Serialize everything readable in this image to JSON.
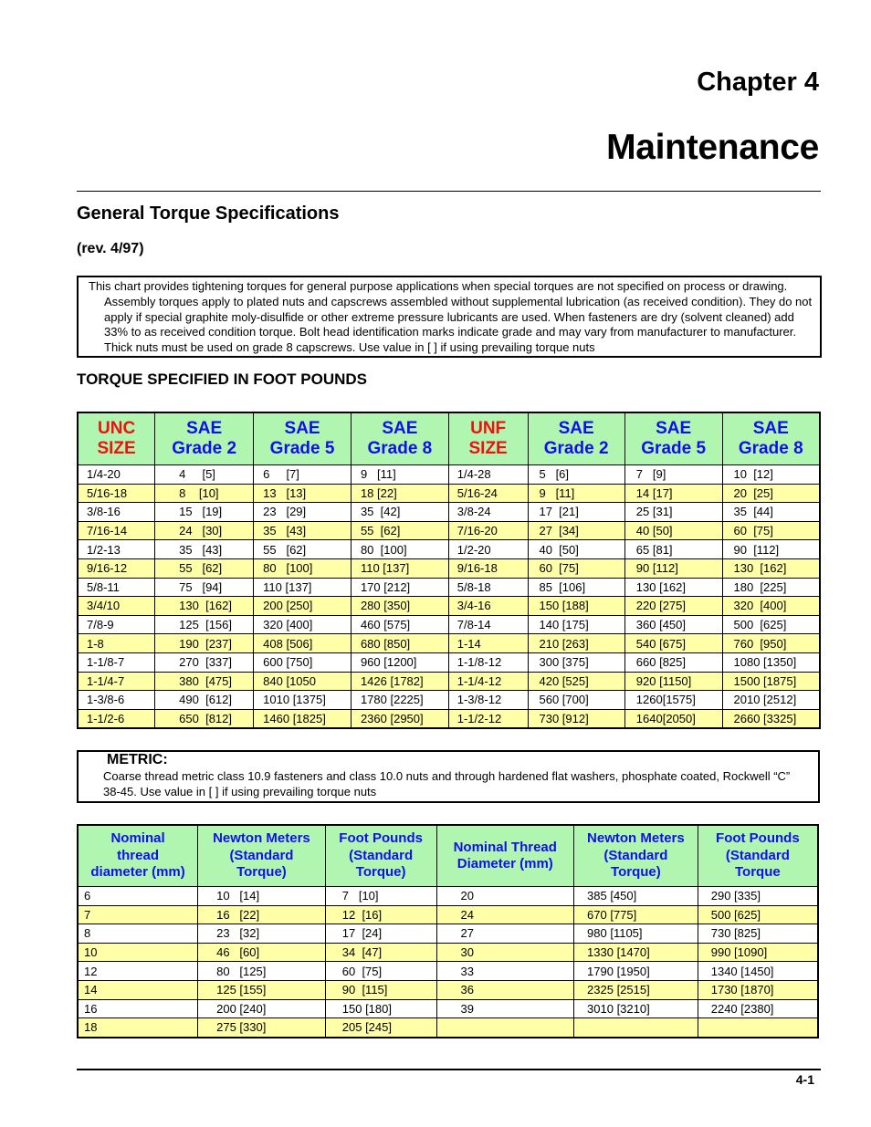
{
  "header": {
    "chapter": "Chapter 4",
    "title": "Maintenance"
  },
  "section": {
    "title": "General Torque Specifications",
    "revision": "(rev. 4/97)",
    "note": "This chart provides tightening torques for general purpose applications when special torques are not specified on process or drawing. Assembly torques apply to plated nuts and capscrews assembled without supplemental lubrication (as received condition). They do not apply if special graphite moly-disulfide or other extreme pressure lubricants are used. When fasteners are dry (solvent cleaned) add 33% to as received condition torque. Bolt head identification marks indicate grade and may vary from manufacturer to manufacturer. Thick nuts must be used on grade 8 capscrews. Use value in [  ] if using prevailing torque nuts"
  },
  "sae_table": {
    "heading": "TORQUE SPECIFIED IN FOOT POUNDS",
    "columns": [
      {
        "line1": "UNC",
        "line2": "SIZE",
        "color": "#ef1010"
      },
      {
        "line1": "SAE",
        "line2": "Grade 2",
        "color": "#1010e8"
      },
      {
        "line1": "SAE",
        "line2": "Grade 5",
        "color": "#1010e8"
      },
      {
        "line1": "SAE",
        "line2": "Grade 8",
        "color": "#1010e8"
      },
      {
        "line1": "UNF",
        "line2": "SIZE",
        "color": "#ef1010"
      },
      {
        "line1": "SAE",
        "line2": "Grade 2",
        "color": "#1010e8"
      },
      {
        "line1": "SAE",
        "line2": "Grade 5",
        "color": "#1010e8"
      },
      {
        "line1": "SAE",
        "line2": "Grade 8",
        "color": "#1010e8"
      }
    ],
    "rows": [
      [
        "1/4-20",
        "4     [5]",
        "6     [7]",
        "9   [11]",
        "1/4-28",
        "5   [6]",
        "7   [9]",
        "10  [12]"
      ],
      [
        "5/16-18",
        "8    [10]",
        "13   [13]",
        "18 [22]",
        "5/16-24",
        "9   [11]",
        "14 [17]",
        "20  [25]"
      ],
      [
        "3/8-16",
        "15   [19]",
        "23   [29]",
        "35  [42]",
        "3/8-24",
        "17  [21]",
        "25 [31]",
        "35  [44]"
      ],
      [
        "7/16-14",
        "24   [30]",
        "35   [43]",
        "55  [62]",
        "7/16-20",
        "27  [34]",
        "40 [50]",
        "60  [75]"
      ],
      [
        "1/2-13",
        "35   [43]",
        "55   [62]",
        "80  [100]",
        "1/2-20",
        "40  [50]",
        "65 [81]",
        "90  [112]"
      ],
      [
        "9/16-12",
        "55   [62]",
        "80   [100]",
        "110 [137]",
        "9/16-18",
        "60  [75]",
        "90 [112]",
        "130  [162]"
      ],
      [
        "5/8-11",
        "75   [94]",
        "110 [137]",
        "170 [212]",
        "5/8-18",
        "85  [106]",
        "130 [162]",
        "180  [225]"
      ],
      [
        "3/4/10",
        "130  [162]",
        "200 [250]",
        "280 [350]",
        "3/4-16",
        "150 [188]",
        "220 [275]",
        "320  [400]"
      ],
      [
        "7/8-9",
        "125  [156]",
        "320 [400]",
        "460 [575]",
        "7/8-14",
        "140 [175]",
        "360 [450]",
        "500  [625]"
      ],
      [
        "1-8",
        "190  [237]",
        "408 [506]",
        "680 [850]",
        "1-14",
        "210 [263]",
        "540 [675]",
        "760  [950]"
      ],
      [
        "1-1/8-7",
        "270  [337]",
        "600 [750]",
        "960 [1200]",
        "1-1/8-12",
        "300 [375]",
        "660 [825]",
        "1080 [1350]"
      ],
      [
        "1-1/4-7",
        "380  [475]",
        "840 [1050",
        "1426 [1782]",
        "1-1/4-12",
        "420 [525]",
        "920 [1150]",
        "1500 [1875]"
      ],
      [
        "1-3/8-6",
        "490  [612]",
        "1010 [1375]",
        "1780 [2225]",
        "1-3/8-12",
        "560 [700]",
        "1260[1575]",
        "2010 [2512]"
      ],
      [
        "1-1/2-6",
        "650  [812]",
        "1460 [1825]",
        "2360 [2950]",
        "1-1/2-12",
        "730 [912]",
        "1640[2050]",
        "2660 [3325]"
      ]
    ]
  },
  "metric": {
    "heading": "METRIC:",
    "note": "Coarse thread metric class 10.9 fasteners and class 10.0 nuts and through hardened flat washers, phosphate coated, Rockwell “C” 38-45. Use value in [   ]  if using prevailing torque nuts",
    "columns": [
      [
        "Nominal",
        "thread",
        "diameter (mm)"
      ],
      [
        "Newton Meters",
        "(Standard",
        "Torque)"
      ],
      [
        "Foot Pounds",
        "(Standard",
        "Torque)"
      ],
      [
        "Nominal Thread",
        "Diameter (mm)"
      ],
      [
        "Newton Meters",
        "(Standard",
        "Torque)"
      ],
      [
        "Foot Pounds",
        "(Standard",
        "Torque"
      ]
    ],
    "rows": [
      [
        "6",
        "10   [14]",
        "7   [10]",
        "20",
        "385 [450]",
        "290 [335]"
      ],
      [
        "7",
        "16   [22]",
        "12  [16]",
        "24",
        "670 [775]",
        "500 [625]"
      ],
      [
        "8",
        "23   [32]",
        "17  [24]",
        "27",
        "980 [1105]",
        "730 [825]"
      ],
      [
        "10",
        "46   [60]",
        "34  [47]",
        "30",
        "1330 [1470]",
        "990 [1090]"
      ],
      [
        "12",
        "80   [125]",
        "60  [75]",
        "33",
        "1790 [1950]",
        "1340 [1450]"
      ],
      [
        "14",
        "125 [155]",
        "90  [115]",
        "36",
        "2325 [2515]",
        "1730 [1870]"
      ],
      [
        "16",
        "200 [240]",
        "150 [180]",
        "39",
        "3010 [3210]",
        "2240 [2380]"
      ],
      [
        "18",
        "275 [330]",
        "205 [245]",
        "",
        "",
        ""
      ]
    ]
  },
  "footer": {
    "page_number": "4-1"
  }
}
